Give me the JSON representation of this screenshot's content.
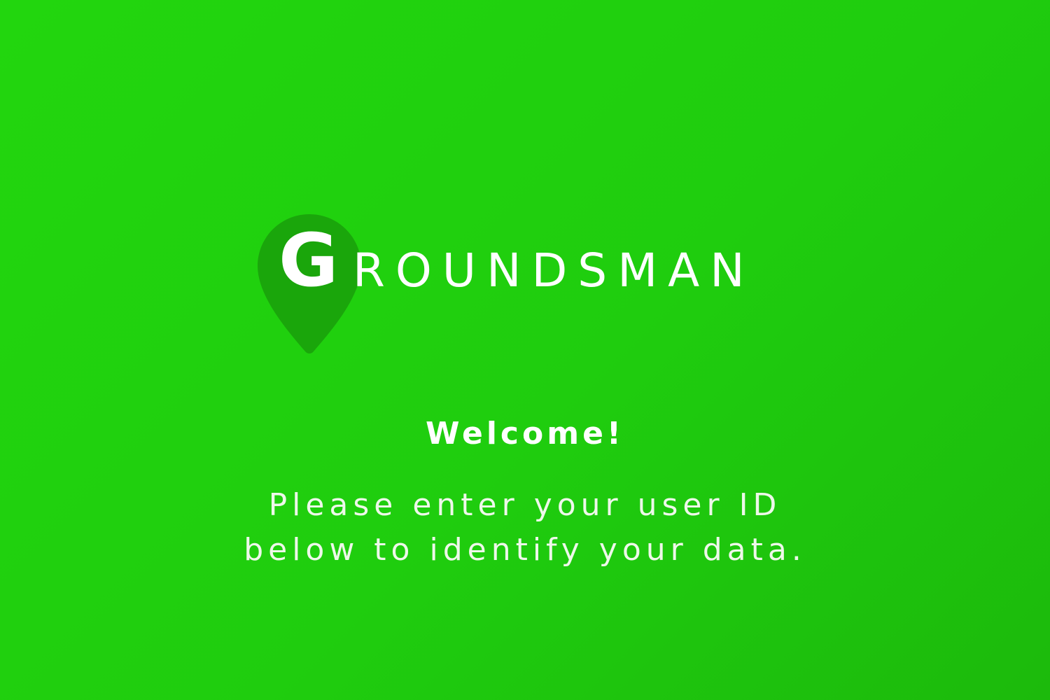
{
  "brand": {
    "logo_initial": "G",
    "logo_rest": "ROUNDSMAN",
    "icon": "map-pin-icon",
    "pin_color": "#1aa60b",
    "background_start": "#22d60e",
    "background_end": "#1cba0c"
  },
  "welcome": {
    "heading": "Welcome!",
    "line1": "Please enter your user ID",
    "line2": "below to identify your data."
  }
}
